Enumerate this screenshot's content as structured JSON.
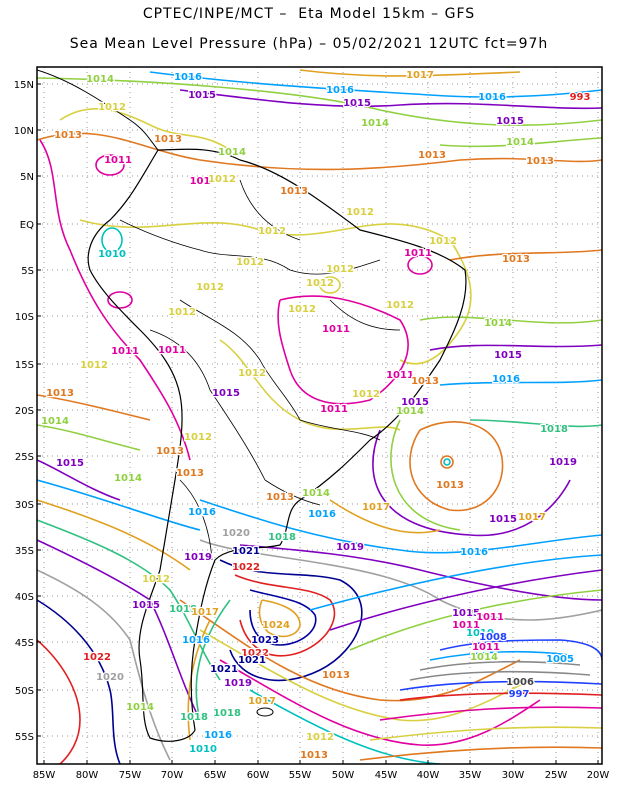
{
  "title": {
    "line1": "CPTEC/INPE/MCT –  Eta Model 15km – GFS",
    "line2": "Sea Mean Level Pressure (hPa) – 05/02/2021 12UTC fct=97h"
  },
  "axes": {
    "lat_labels": [
      "15N",
      "10N",
      "5N",
      "EQ",
      "5S",
      "10S",
      "15S",
      "20S",
      "25S",
      "30S",
      "35S",
      "40S",
      "45S",
      "50S",
      "55S"
    ],
    "lon_labels": [
      "85W",
      "80W",
      "75W",
      "70W",
      "65W",
      "60W",
      "55W",
      "50W",
      "45W",
      "40W",
      "35W",
      "30W",
      "25W",
      "20W"
    ]
  },
  "colors": {
    "1008": "#2040ff",
    "1009": "#00a0ff",
    "1010": "#00c0c0",
    "1011": "#e000a0",
    "1012": "#d8d040",
    "1013": "#e07820",
    "1014": "#90d040",
    "1015": "#8000c0",
    "1016": "#00a0ff",
    "1017": "#e0a020",
    "1018": "#30c080",
    "1019": "#8000c0",
    "1020": "#a0a0a0",
    "1021": "#000090",
    "1022": "#e02020",
    "1023": "#0000a0",
    "1024": "#e0a020",
    "997": "#2040ff",
    "993": "#e02020"
  },
  "isobar_labels": [
    {
      "text": "1014",
      "c": "1014"
    },
    {
      "text": "1016",
      "c": "1016"
    },
    {
      "text": "1015",
      "c": "1015"
    },
    {
      "text": "1017",
      "c": "1017"
    },
    {
      "text": "1016",
      "c": "1016"
    },
    {
      "text": "1012",
      "c": "1012"
    },
    {
      "text": "1015",
      "c": "1015"
    },
    {
      "text": "1016",
      "c": "1016"
    },
    {
      "text": "1013",
      "c": "1013"
    },
    {
      "text": "1014",
      "c": "1014"
    },
    {
      "text": "1015",
      "c": "1015"
    },
    {
      "text": "1013",
      "c": "1013"
    },
    {
      "text": "1014",
      "c": "1014"
    },
    {
      "text": "1013",
      "c": "1013"
    },
    {
      "text": "1011",
      "c": "1011"
    },
    {
      "text": "1014",
      "c": "1014"
    },
    {
      "text": "101",
      "c": "1011"
    },
    {
      "text": "1012",
      "c": "1012"
    },
    {
      "text": "1013",
      "c": "1013"
    },
    {
      "text": "1013",
      "c": "1013"
    },
    {
      "text": "1012",
      "c": "1012"
    },
    {
      "text": "1012",
      "c": "1012"
    },
    {
      "text": "1012",
      "c": "1012"
    },
    {
      "text": "1010",
      "c": "1010"
    },
    {
      "text": "1012",
      "c": "1012"
    },
    {
      "text": "1011",
      "c": "1011"
    },
    {
      "text": "1012",
      "c": "1012"
    },
    {
      "text": "1013",
      "c": "1013"
    },
    {
      "text": "1012",
      "c": "1012"
    },
    {
      "text": "1012",
      "c": "1012"
    },
    {
      "text": "1012",
      "c": "1012"
    },
    {
      "text": "1012",
      "c": "1012"
    },
    {
      "text": "1012",
      "c": "1012"
    },
    {
      "text": "1014",
      "c": "1014"
    },
    {
      "text": "1011",
      "c": "1011"
    },
    {
      "text": "1011",
      "c": "1011"
    },
    {
      "text": "1011",
      "c": "1011"
    },
    {
      "text": "1012",
      "c": "1012"
    },
    {
      "text": "1012",
      "c": "1012"
    },
    {
      "text": "1015",
      "c": "1015"
    },
    {
      "text": "1011",
      "c": "1011"
    },
    {
      "text": "1013",
      "c": "1013"
    },
    {
      "text": "1016",
      "c": "1016"
    },
    {
      "text": "1013",
      "c": "1013"
    },
    {
      "text": "1015",
      "c": "1015"
    },
    {
      "text": "1012",
      "c": "1012"
    },
    {
      "text": "1011",
      "c": "1011"
    },
    {
      "text": "1014",
      "c": "1014"
    },
    {
      "text": "1018",
      "c": "1018"
    },
    {
      "text": "1014",
      "c": "1014"
    },
    {
      "text": "1015",
      "c": "1015"
    },
    {
      "text": "1012",
      "c": "1012"
    },
    {
      "text": "1013",
      "c": "1013"
    },
    {
      "text": "1013",
      "c": "1013"
    },
    {
      "text": "1015",
      "c": "1015"
    },
    {
      "text": "1019",
      "c": "1019"
    },
    {
      "text": "1014",
      "c": "1014"
    },
    {
      "text": "1013",
      "c": "1013"
    },
    {
      "text": "1014",
      "c": "1014"
    },
    {
      "text": "1013",
      "c": "1013"
    },
    {
      "text": "1016",
      "c": "1016"
    },
    {
      "text": "1016",
      "c": "1016"
    },
    {
      "text": "1017",
      "c": "1017"
    },
    {
      "text": "1015",
      "c": "1015"
    },
    {
      "text": "1017",
      "c": "1017"
    },
    {
      "text": "1020",
      "c": "1020"
    },
    {
      "text": "1018",
      "c": "1018"
    },
    {
      "text": "1019",
      "c": "1019"
    },
    {
      "text": "1021",
      "c": "1021"
    },
    {
      "text": "1016",
      "c": "1016"
    },
    {
      "text": "1022",
      "c": "1022"
    },
    {
      "text": "1019",
      "c": "1019"
    },
    {
      "text": "1012",
      "c": "1012"
    },
    {
      "text": "1015",
      "c": "1015"
    },
    {
      "text": "1018",
      "c": "1018"
    },
    {
      "text": "1017",
      "c": "1017"
    },
    {
      "text": "1024",
      "c": "1024"
    },
    {
      "text": "1016",
      "c": "1016"
    },
    {
      "text": "1023",
      "c": "1023"
    },
    {
      "text": "1022",
      "c": "1022"
    },
    {
      "text": "1022",
      "c": "1022"
    },
    {
      "text": "1021",
      "c": "1021"
    },
    {
      "text": "1020",
      "c": "1020"
    },
    {
      "text": "1021",
      "c": "1021"
    },
    {
      "text": "1013",
      "c": "1013"
    },
    {
      "text": "1018",
      "c": "1018"
    },
    {
      "text": "1019",
      "c": "1019"
    },
    {
      "text": "1014",
      "c": "1014"
    },
    {
      "text": "1018",
      "c": "1018"
    },
    {
      "text": "1017",
      "c": "1017"
    },
    {
      "text": "1016",
      "c": "1016"
    },
    {
      "text": "1015",
      "c": "1015"
    },
    {
      "text": "1011",
      "c": "1011"
    },
    {
      "text": "1012",
      "c": "1012"
    },
    {
      "text": "1010",
      "c": "1010"
    },
    {
      "text": "1013",
      "c": "1013"
    },
    {
      "text": "1011",
      "c": "1011"
    },
    {
      "text": "1011",
      "c": "1011"
    },
    {
      "text": "1010",
      "c": "1010"
    },
    {
      "text": "1008",
      "c": "1008"
    },
    {
      "text": "1014",
      "c": "1014"
    },
    {
      "text": "1005",
      "c": "1009"
    },
    {
      "text": "1006",
      "c": "1006"
    },
    {
      "text": "997",
      "c": "997"
    },
    {
      "text": "993",
      "c": "993"
    }
  ]
}
